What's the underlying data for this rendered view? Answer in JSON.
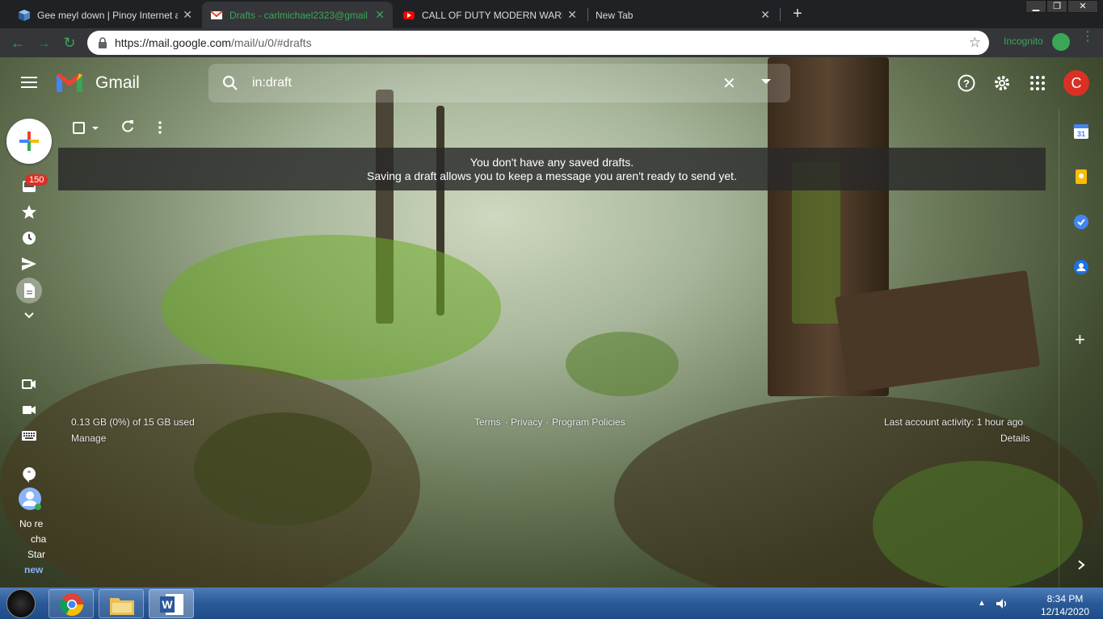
{
  "browser": {
    "tabs": [
      {
        "title": "Gee meyl down | Pinoy Internet a",
        "active": false
      },
      {
        "title": "Drafts - carlmichael2323@gmail",
        "active": true
      },
      {
        "title": "CALL OF DUTY MODERN WARFA",
        "active": false
      },
      {
        "title": "New Tab",
        "active": false
      }
    ],
    "url_host": "https://mail.google.com",
    "url_path": "/mail/u/0/#drafts",
    "incognito_label": "Incognito"
  },
  "gmail": {
    "app_name": "Gmail",
    "search_value": "in:draft",
    "avatar_letter": "C",
    "inbox_badge": "150",
    "empty_title": "You don't have any saved drafts.",
    "empty_subtitle": "Saving a draft allows you to keep a message you aren't ready to send yet.",
    "storage": "0.13 GB (0%) of 15 GB used",
    "manage": "Manage",
    "terms": "Terms",
    "privacy": "Privacy",
    "program_policies": "Program Policies",
    "sep": "·",
    "last_activity": "Last account activity: 1 hour ago",
    "details": "Details",
    "hangouts": {
      "line1": "No re",
      "line2": "cha",
      "line3": "Star",
      "line4": "new"
    }
  },
  "taskbar": {
    "time": "8:34 PM",
    "date": "12/14/2020"
  },
  "colors": {
    "gmail_red": "#d93025",
    "chrome_green": "#3aa757",
    "taskbar_blue": "#2a5a97"
  }
}
